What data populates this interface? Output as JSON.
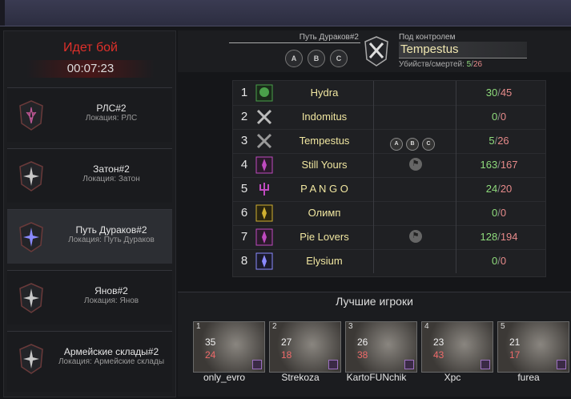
{
  "battle": {
    "title": "Идет бой",
    "timer": "00:07:23"
  },
  "locations": [
    {
      "title": "РЛС#2",
      "sub": "Локация: РЛС",
      "icon": "bandits-shield-icon"
    },
    {
      "title": "Затон#2",
      "sub": "Локация: Затон",
      "icon": "star-shield-icon"
    },
    {
      "title": "Путь Дураков#2",
      "sub": "Локация: Путь Дураков",
      "icon": "blue-star-shield-icon"
    },
    {
      "title": "Янов#2",
      "sub": "Локация: Янов",
      "icon": "star-shield-icon"
    },
    {
      "title": "Армейские склады#2",
      "sub": "Локация: Армейские склады",
      "icon": "star-shield-icon"
    }
  ],
  "header": {
    "location": "Путь Дураков#2",
    "caps": [
      "A",
      "B",
      "C"
    ],
    "control_label": "Под контролем",
    "control_name": "Tempestus",
    "kd_label": "Убийств/смертей:",
    "kills": "5",
    "deaths": "26"
  },
  "rows": [
    {
      "rank": "1",
      "name": "Hydra",
      "kills": "30",
      "deaths": "45",
      "caps": [],
      "flag": false
    },
    {
      "rank": "2",
      "name": "Indomitus",
      "kills": "0",
      "deaths": "0",
      "caps": [],
      "flag": false
    },
    {
      "rank": "3",
      "name": "Tempestus",
      "kills": "5",
      "deaths": "26",
      "caps": [
        "A",
        "B",
        "C"
      ],
      "flag": false
    },
    {
      "rank": "4",
      "name": "Still Yours",
      "kills": "163",
      "deaths": "167",
      "caps": [],
      "flag": true
    },
    {
      "rank": "5",
      "name": "P A N G O",
      "kills": "24",
      "deaths": "20",
      "caps": [],
      "flag": false
    },
    {
      "rank": "6",
      "name": "Олимп",
      "kills": "0",
      "deaths": "0",
      "caps": [],
      "flag": false
    },
    {
      "rank": "7",
      "name": "Pie Lovers",
      "kills": "128",
      "deaths": "194",
      "caps": [],
      "flag": true
    },
    {
      "rank": "8",
      "name": "Elysium",
      "kills": "0",
      "deaths": "0",
      "caps": [],
      "flag": false
    }
  ],
  "emblem_colors": [
    "#4aa04a",
    "#bcbcbc",
    "#9a9a9a",
    "#c04ac0",
    "#c04ac0",
    "#d0b030",
    "#c04ac0",
    "#8a8aff"
  ],
  "best_title": "Лучшие игроки",
  "players": [
    {
      "pos": "1",
      "kills": "35",
      "deaths": "24",
      "name": "only_evro"
    },
    {
      "pos": "2",
      "kills": "27",
      "deaths": "18",
      "name": "Strekoza"
    },
    {
      "pos": "3",
      "kills": "26",
      "deaths": "38",
      "name": "KartoFUNchik"
    },
    {
      "pos": "4",
      "kills": "23",
      "deaths": "43",
      "name": "Xpc"
    },
    {
      "pos": "5",
      "kills": "21",
      "deaths": "17",
      "name": "furea"
    }
  ]
}
